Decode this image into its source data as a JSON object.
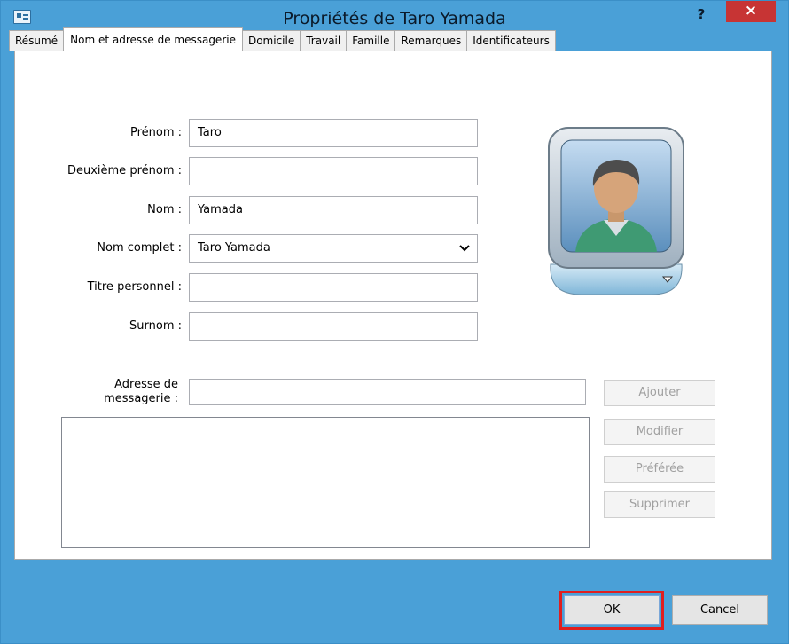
{
  "window": {
    "title": "Propriétés de Taro Yamada",
    "help_glyph": "?",
    "close_glyph": "×"
  },
  "tabs": [
    {
      "label": "Résumé",
      "active": false
    },
    {
      "label": "Nom et adresse de messagerie",
      "active": true
    },
    {
      "label": "Domicile",
      "active": false
    },
    {
      "label": "Travail",
      "active": false
    },
    {
      "label": "Famille",
      "active": false
    },
    {
      "label": "Remarques",
      "active": false
    },
    {
      "label": "Identificateurs",
      "active": false
    }
  ],
  "form": {
    "first_name_label": "Prénom :",
    "first_name_value": "Taro",
    "middle_name_label": "Deuxième prénom :",
    "middle_name_value": "",
    "last_name_label": "Nom :",
    "last_name_value": "Yamada",
    "full_name_label": "Nom complet :",
    "full_name_value": "Taro Yamada",
    "title_label": "Titre personnel :",
    "title_value": "",
    "nickname_label": "Surnom :",
    "nickname_value": "",
    "email_label_line1": "Adresse de",
    "email_label_line2": "messagerie :",
    "email_value": ""
  },
  "email_buttons": {
    "add": "Ajouter",
    "edit": "Modifier",
    "preferred": "Préférée",
    "delete": "Supprimer"
  },
  "footer": {
    "ok": "OK",
    "cancel": "Cancel"
  },
  "colors": {
    "titlebar": "#4aa0d7",
    "close": "#c73434",
    "highlight": "#e01e1e"
  }
}
